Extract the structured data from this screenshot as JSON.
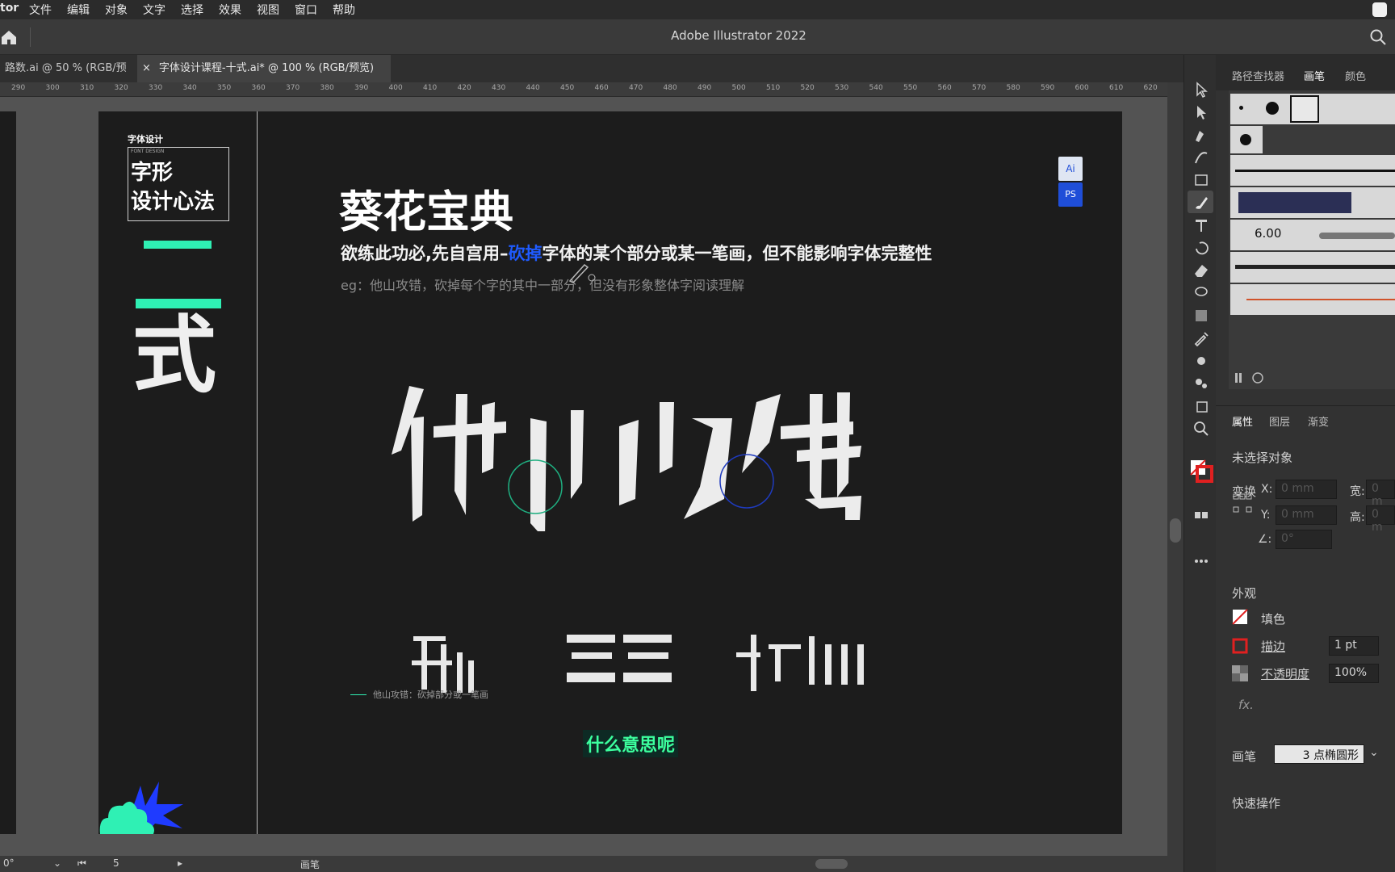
{
  "menubar": {
    "app_fragment": "tor",
    "items": [
      "文件",
      "编辑",
      "对象",
      "文字",
      "选择",
      "效果",
      "视图",
      "窗口",
      "帮助"
    ]
  },
  "titlebar": {
    "title": "Adobe Illustrator 2022"
  },
  "tabs": [
    {
      "label": "路数.ai @ 50 % (RGB/预览)"
    },
    {
      "label": "字体设计课程-十式.ai* @ 100 % (RGB/预览)",
      "close": "×"
    }
  ],
  "ruler": {
    "ticks": [
      "290",
      "300",
      "310",
      "320",
      "330",
      "340",
      "350",
      "360",
      "370",
      "380",
      "390",
      "400",
      "410",
      "420",
      "430",
      "440",
      "450",
      "460",
      "470",
      "480",
      "490",
      "500",
      "510",
      "520",
      "530",
      "540",
      "550",
      "560",
      "570",
      "580",
      "590",
      "600",
      "610",
      "620"
    ]
  },
  "artboard": {
    "side": {
      "small_title": "字体设计",
      "font_design": "FONT DESIGN",
      "box_line1": "字形",
      "box_line2": "设计心法",
      "big_char": "式"
    },
    "heading": "葵花宝典",
    "line1_pre": "欲练此功必,先自宫用–",
    "line1_highlight": "砍掉",
    "line1_post": "字体的某个部分或某一笔画，但不能影响字体完整性",
    "line2": "eg：他山攻错，砍掉每个字的其中一部分，但没有形象整体字阅读理解",
    "badge_ai": "Ai",
    "badge_ps": "PS",
    "caption": "他山攻错：砍掉部分或一笔画",
    "subtitle": "什么意思呢",
    "colors": {
      "accent": "#2ff0b4",
      "highlight": "#1f5bff",
      "artboard": "#1c1c1c"
    }
  },
  "status": {
    "rotation": "0°",
    "page": "5",
    "tool": "画笔"
  },
  "panel": {
    "top_tabs": [
      "路径查找器",
      "画笔",
      "颜色"
    ],
    "brush_size": "6.00",
    "tabs2": [
      "属性",
      "图层",
      "渐变"
    ],
    "no_selection": "未选择对象",
    "transform": "变换",
    "x_label": "X:",
    "y_label": "Y:",
    "x_value": "0 mm",
    "y_value": "0 mm",
    "w_label": "宽:",
    "h_label": "高:",
    "w_value": "0 m",
    "h_value": "0 m",
    "angle_value": "0°",
    "appearance": "外观",
    "fill": "填色",
    "stroke": "描边",
    "stroke_value": "1 pt",
    "opacity": "不透明度",
    "opacity_value": "100%",
    "fx": "fx.",
    "brush_label": "画笔",
    "brush_value": "3 点椭圆形",
    "quick_actions": "快速操作"
  }
}
